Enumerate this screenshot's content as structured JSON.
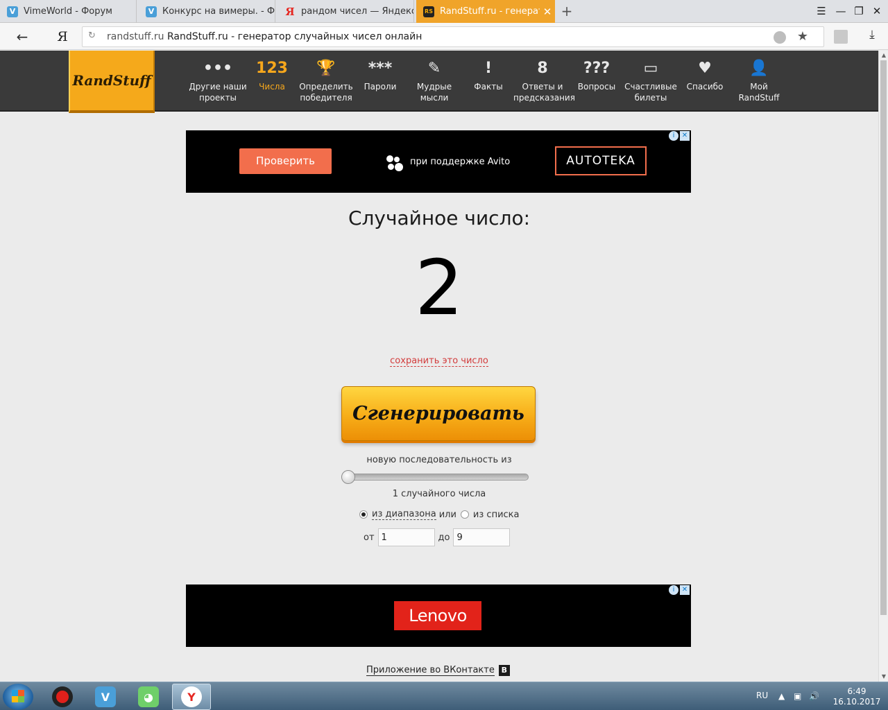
{
  "browser": {
    "tabs": [
      {
        "title": "VimeWorld - Форум",
        "favicon": "vimeworld-icon"
      },
      {
        "title": "Конкурс на вимеры. - Флуд",
        "favicon": "vimeworld-icon"
      },
      {
        "title": "рандом чисел — Яндекс: на",
        "favicon": "yandex-icon"
      },
      {
        "title": "RandStuff.ru - генератор",
        "favicon": "randstuff-icon"
      }
    ],
    "active_tab": 3,
    "new_tab_glyph": "+",
    "url_host": "randstuff.ru",
    "url_title": "RandStuff.ru - генератор случайных чисел онлайн",
    "yandex_glyph": "Я"
  },
  "site": {
    "logo": "RandStuff",
    "nav": [
      {
        "label": "Другие наши проекты",
        "icon": "•••"
      },
      {
        "label": "Числа",
        "icon": "123",
        "active": true
      },
      {
        "label": "Определить победителя",
        "icon": "🏆"
      },
      {
        "label": "Пароли",
        "icon": "***"
      },
      {
        "label": "Мудрые мысли",
        "icon": "✎"
      },
      {
        "label": "Факты",
        "icon": "!"
      },
      {
        "label": "Ответы и предсказания",
        "icon": "8"
      },
      {
        "label": "Вопросы",
        "icon": "???"
      },
      {
        "label": "Счастливые билеты",
        "icon": "▭"
      },
      {
        "label": "Спасибо",
        "icon": "♥"
      },
      {
        "label": "Мой RandStuff",
        "icon": "👤"
      }
    ]
  },
  "ads": {
    "top": {
      "button": "Проверить",
      "support_text": "при поддержке Avito",
      "brand": "AUTOTEKA"
    },
    "bottom": {
      "brand": "Lenovo"
    },
    "info_glyph": "i",
    "close_glyph": "✕"
  },
  "generator": {
    "heading": "Случайное число:",
    "result": "2",
    "save_link": "сохранить это число",
    "button": "Сгенерировать",
    "sequence_label": "новую последовательность из",
    "count_label": "1 случайного числа",
    "mode_range": "из диапазона",
    "mode_or": "или",
    "mode_list": "из списка",
    "from_label": "от",
    "from_value": "1",
    "to_label": "до",
    "to_value": "9",
    "slider_value": 1
  },
  "footer": {
    "vk_link": "Приложение во ВКонтакте",
    "vk_badge": "В"
  },
  "taskbar": {
    "lang": "RU",
    "time": "6:49",
    "date": "16.10.2017"
  },
  "colors": {
    "accent": "#f5a91b",
    "nav_bg": "#3a3a3a",
    "link_red": "#d23b3b"
  }
}
